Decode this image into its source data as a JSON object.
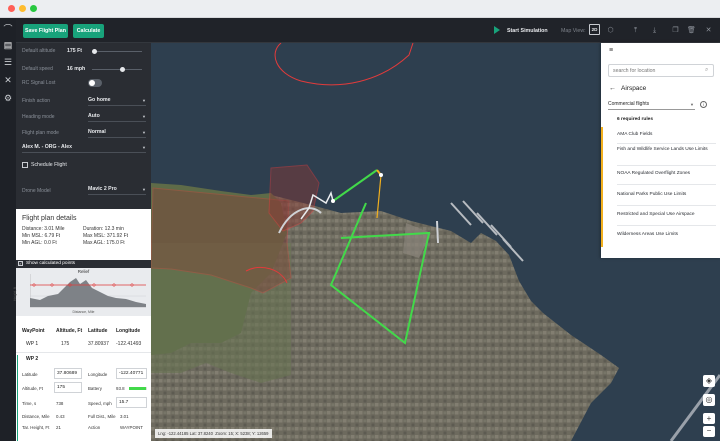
{
  "toolbar": {
    "save_flight_plan": "Save Flight Plan",
    "calculate": "Calculate",
    "start_simulation": "Start Simulation",
    "map_view": "Map View:",
    "map_view_mode": "2D"
  },
  "settings": {
    "default_altitude_label": "Default altitude",
    "default_altitude_value": "175 Ft",
    "default_speed_label": "Default speed",
    "default_speed_value": "16 mph",
    "rc_signal_lost_label": "RC Signal Lost",
    "finish_action_label": "Finish action",
    "finish_action_value": "Go home",
    "heading_mode_label": "Heading mode",
    "heading_mode_value": "Auto",
    "flight_plan_mode_label": "Flight plan mode",
    "flight_plan_mode_value": "Normal",
    "org_value": "Alex M. - ORG - Alex",
    "schedule_flight_label": "Schedule Flight",
    "drone_model_label": "Drone Model",
    "drone_model_value": "Mavic 2 Pro"
  },
  "details": {
    "title": "Flight plan details",
    "distance": "Distance: 3.01 Mile",
    "duration": "Duration: 12.3 min",
    "min_msl": "Min MSL: 6.79 Ft",
    "max_msl": "Max MSL: 371.92 Ft",
    "min_agl": "Min AGL: 0.0 Ft",
    "max_agl": "Max AGL: 175.0 Ft",
    "show_points": "Show calculated points",
    "relief_title": "Relief",
    "relief_ylabel": "Height, ft",
    "relief_xlabel": "Distance, Mile",
    "table_headers": [
      "WayPoint",
      "Altitude, Ft",
      "Latitude",
      "Longitude"
    ],
    "wp1": {
      "name": "WP 1",
      "alt": "175",
      "lat": "37.80937",
      "lon": "-122.41493"
    },
    "wp2_name": "WP 2",
    "wp2_fields": {
      "lat_label": "Latitude",
      "lat_value": "37.80689",
      "lon_label": "Longitude",
      "lon_value": "-122.40771",
      "alt_label": "Altitude, Ft",
      "alt_value": "175",
      "battery_label": "Battery",
      "battery_value": "93.8",
      "time_label": "Time, s",
      "time_value": "738",
      "speed_label": "Speed, mph",
      "speed_value": "15.7",
      "dist_label": "Distance, Mile",
      "dist_value": "0.43",
      "full_dist_label": "Full Dist., Mile",
      "full_dist_value": "3.01",
      "tar_label": "Tar. Height, Ft",
      "tar_value": "21",
      "action_label": "Action",
      "action_value": "WAYPOINT"
    },
    "battery_level": 0.938
  },
  "map": {
    "coords": "Lng: -122.44185 Lat: 37.8240",
    "zoom": "Zoom: 15; X: 5238; Y: 12659"
  },
  "airspace": {
    "search_placeholder": "search for location",
    "title": "Airspace",
    "filter_value": "Commercial flights",
    "required_rules": "6 required rules",
    "rules": [
      "AMA Club Fields",
      "Fish and Wildlife Service Lands Use Limits",
      "NOAA Regulated Overflight Zones",
      "National Parks Public Use Limits",
      "Restricted and Special Use Airspace",
      "Wilderness Areas Use Limits"
    ]
  },
  "colors": {
    "accent_green": "#18a37b",
    "route_green": "#42d94a",
    "restricted_red": "#e23b3b",
    "rule_marker": "#f2b01e"
  }
}
